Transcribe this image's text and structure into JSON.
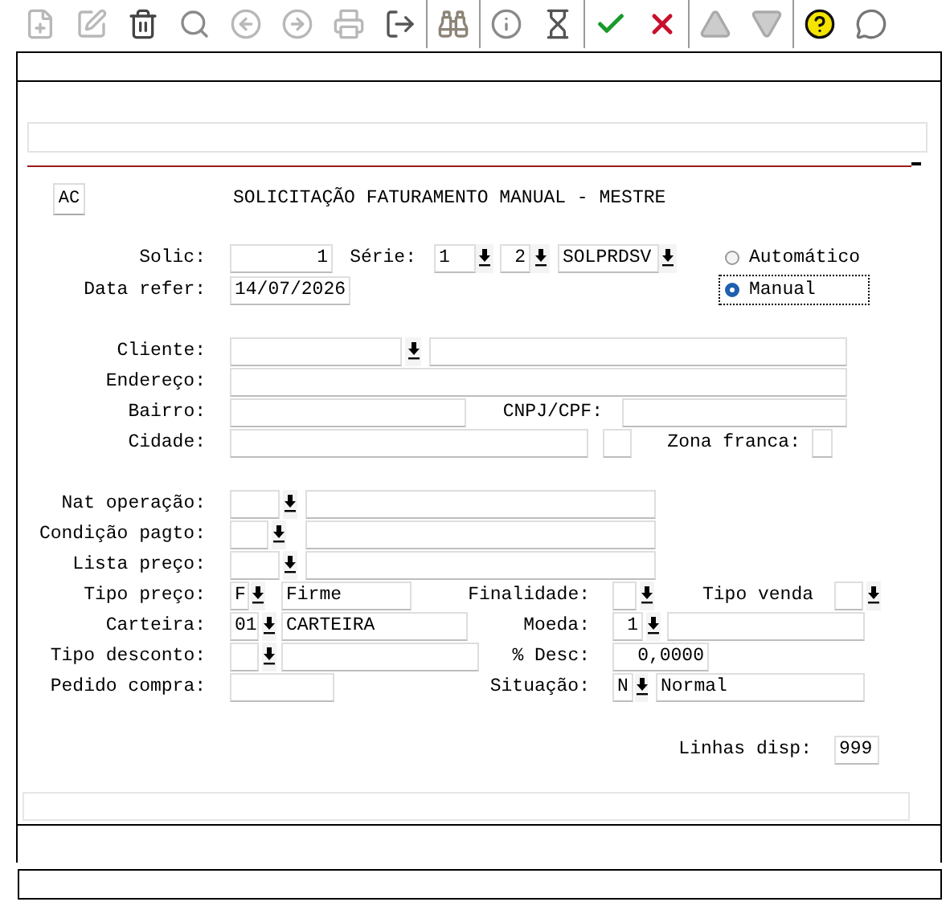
{
  "header": {
    "button": "AC",
    "title": "SOLICITAÇÃO FATURAMENTO MANUAL - MESTRE"
  },
  "solic": {
    "label": "Solic:",
    "value": "1"
  },
  "serie": {
    "label": "Série:",
    "values": [
      "1",
      "2",
      "SOLPRDSV"
    ]
  },
  "mode": [
    {
      "label": "Automático",
      "selected": false
    },
    {
      "label": "Manual",
      "selected": true
    }
  ],
  "data_refer": {
    "label": "Data refer:",
    "value": "14/07/2026"
  },
  "cliente": {
    "label": "Cliente:"
  },
  "endereco": {
    "label": "Endereço:"
  },
  "bairro": {
    "label": "Bairro:"
  },
  "cnpj_cpf": {
    "label": "CNPJ/CPF:"
  },
  "cidade": {
    "label": "Cidade:"
  },
  "zona_franca": {
    "label": "Zona franca:"
  },
  "nat_operacao": {
    "label": "Nat operação:"
  },
  "condicao_pagto": {
    "label": "Condição pagto:"
  },
  "lista_preco": {
    "label": "Lista preço:"
  },
  "tipo_preco": {
    "label": "Tipo preço:",
    "code": "F",
    "description": "Firme"
  },
  "finalidade": {
    "label": "Finalidade:"
  },
  "tipo_venda": {
    "label": "Tipo venda"
  },
  "carteira": {
    "label": "Carteira:",
    "code": "01",
    "description": "CARTEIRA"
  },
  "moeda": {
    "label": "Moeda:",
    "code": "1"
  },
  "tipo_desconto": {
    "label": "Tipo desconto:"
  },
  "desconto": {
    "label": "% Desc:",
    "value": "0,0000"
  },
  "pedido_compra": {
    "label": "Pedido compra:"
  },
  "situacao": {
    "label": "Situação:",
    "code": "N",
    "description": "Normal"
  },
  "linhas_disp": {
    "label": "Linhas disp:",
    "value": "999"
  }
}
